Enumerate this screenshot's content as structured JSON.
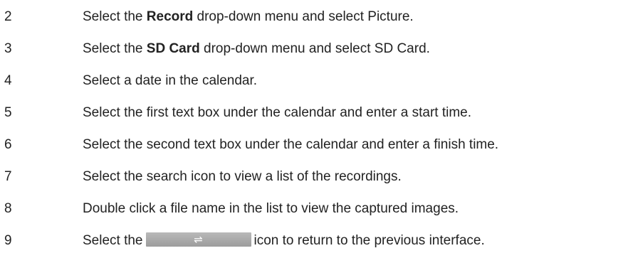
{
  "steps": [
    {
      "number": "2",
      "before": "Select the ",
      "bold": "Record",
      "after": " drop-down menu and select Picture."
    },
    {
      "number": "3",
      "before": "Select the ",
      "bold": "SD Card",
      "after": " drop-down menu and select SD Card."
    },
    {
      "number": "4",
      "text": "Select a date in the calendar."
    },
    {
      "number": "5",
      "text": "Select the first text box under the calendar and enter a start time."
    },
    {
      "number": "6",
      "text": "Select the second text box under the calendar and enter a finish time."
    },
    {
      "number": "7",
      "text": "Select the search icon to view a list of the recordings."
    },
    {
      "number": "8",
      "text": "Double click a file name in the list to view the captured images."
    },
    {
      "number": "9",
      "before": "Select the",
      "icon": "swap-arrows-icon",
      "icon_glyph": "⇌",
      "after": "icon to return to the previous interface."
    }
  ]
}
